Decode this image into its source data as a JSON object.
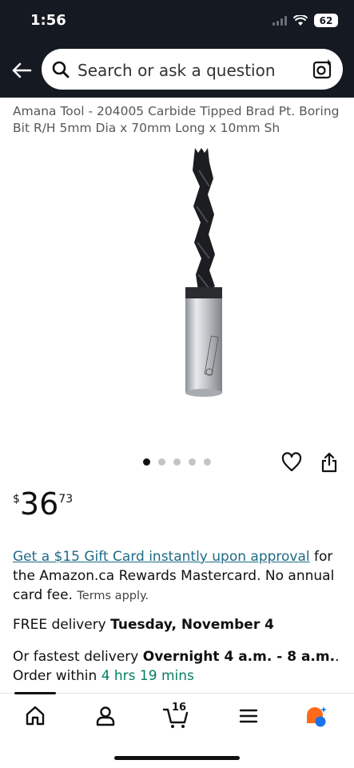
{
  "status_bar": {
    "time": "1:56",
    "battery": "62"
  },
  "search": {
    "placeholder": "Search or ask a question"
  },
  "product": {
    "title": "Amana Tool - 204005 Carbide Tipped Brad Pt. Boring Bit R/H 5mm Dia x 70mm Long x 10mm Sh",
    "image_count": 5,
    "active_image": 1,
    "price": {
      "symbol": "$",
      "whole": "36",
      "fraction": "73"
    }
  },
  "promo": {
    "link_text": "Get a $15 Gift Card instantly upon approval",
    "body": " for the Amazon.ca Rewards Mastercard. No annual card fee. ",
    "terms": "Terms apply."
  },
  "delivery": {
    "prefix": "FREE delivery ",
    "date": "Tuesday, November 4"
  },
  "fastest": {
    "prefix": "Or fastest delivery ",
    "window": "Overnight 4 a.m. - 8 a.m.",
    "suffix": ". Order within ",
    "countdown": "4 hrs 19 mins"
  },
  "tabbar": {
    "cart_count": "16",
    "icons": [
      "home-icon",
      "account-icon",
      "cart-icon",
      "menu-icon",
      "rufus-icon"
    ]
  }
}
